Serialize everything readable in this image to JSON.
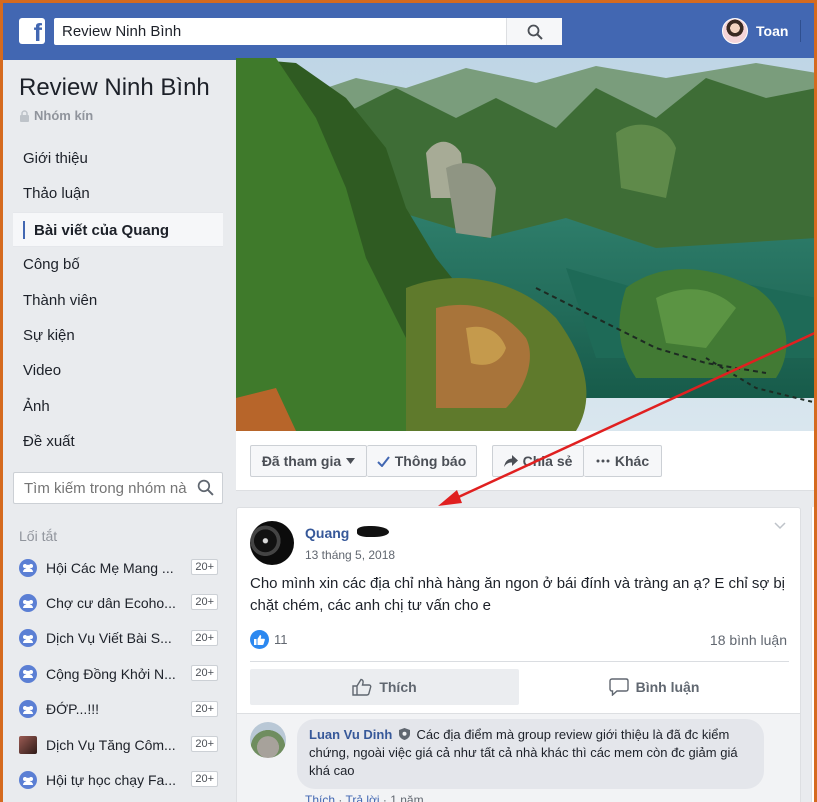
{
  "header": {
    "search_value": "Review Ninh Bình",
    "user_name": "Toan"
  },
  "group": {
    "name": "Review Ninh Bình",
    "privacy": "Nhóm kín"
  },
  "sidebar": {
    "items": [
      {
        "label": "Giới thiệu"
      },
      {
        "label": "Thảo luận"
      },
      {
        "label": "Bài viết của Quang"
      },
      {
        "label": "Công bố"
      },
      {
        "label": "Thành viên"
      },
      {
        "label": "Sự kiện"
      },
      {
        "label": "Video"
      },
      {
        "label": "Ảnh"
      },
      {
        "label": "Đề xuất"
      }
    ],
    "active_index": 2,
    "search_placeholder": "Tìm kiếm trong nhóm nà"
  },
  "shortcuts": {
    "title": "Lối tắt",
    "items": [
      {
        "label": "Hội Các Mẹ Mang ...",
        "badge": "20+",
        "icon": "group-icon"
      },
      {
        "label": "Chợ cư dân Ecoho...",
        "badge": "20+",
        "icon": "group-icon"
      },
      {
        "label": "Dịch Vụ Viết Bài S...",
        "badge": "20+",
        "icon": "group-icon"
      },
      {
        "label": "Cộng Đồng Khởi N...",
        "badge": "20+",
        "icon": "group-icon"
      },
      {
        "label": "ĐỚP...!!!",
        "badge": "20+",
        "icon": "group-icon"
      },
      {
        "label": "Dịch Vụ Tăng Côm...",
        "badge": "20+",
        "icon": "photo-icon"
      },
      {
        "label": "Hội tự học chạy Fa...",
        "badge": "20+",
        "icon": "group-icon"
      }
    ]
  },
  "actions": {
    "joined": "Đã tham gia",
    "notifications": "Thông báo",
    "share": "Chia sẻ",
    "more": "Khác"
  },
  "post": {
    "author": "Quang",
    "date": "13 tháng 5, 2018",
    "text": "Cho mình xin các địa chỉ nhà hàng ăn ngon ở bái đính và tràng an ạ? E chỉ sợ bị chặt chém, các anh chị tư vấn cho e",
    "likes": "11",
    "comments": "18 bình luận",
    "like_label": "Thích",
    "comment_label": "Bình luận"
  },
  "comment": {
    "author": "Luan Vu Dinh",
    "text": "Các địa điểm mà group review giới thiệu là đã đc kiểm chứng, ngoài việc giá cả như tất cả nhà khác thì các mem còn đc giảm giá khá cao",
    "like": "Thích",
    "sep1": " · ",
    "reply": "Trả lời",
    "sep2": " · ",
    "time": "1 năm"
  },
  "colors": {
    "brand": "#4267b2",
    "frame": "#d56a1f",
    "annotation_arrow": "#e02020",
    "link": "#365899"
  }
}
